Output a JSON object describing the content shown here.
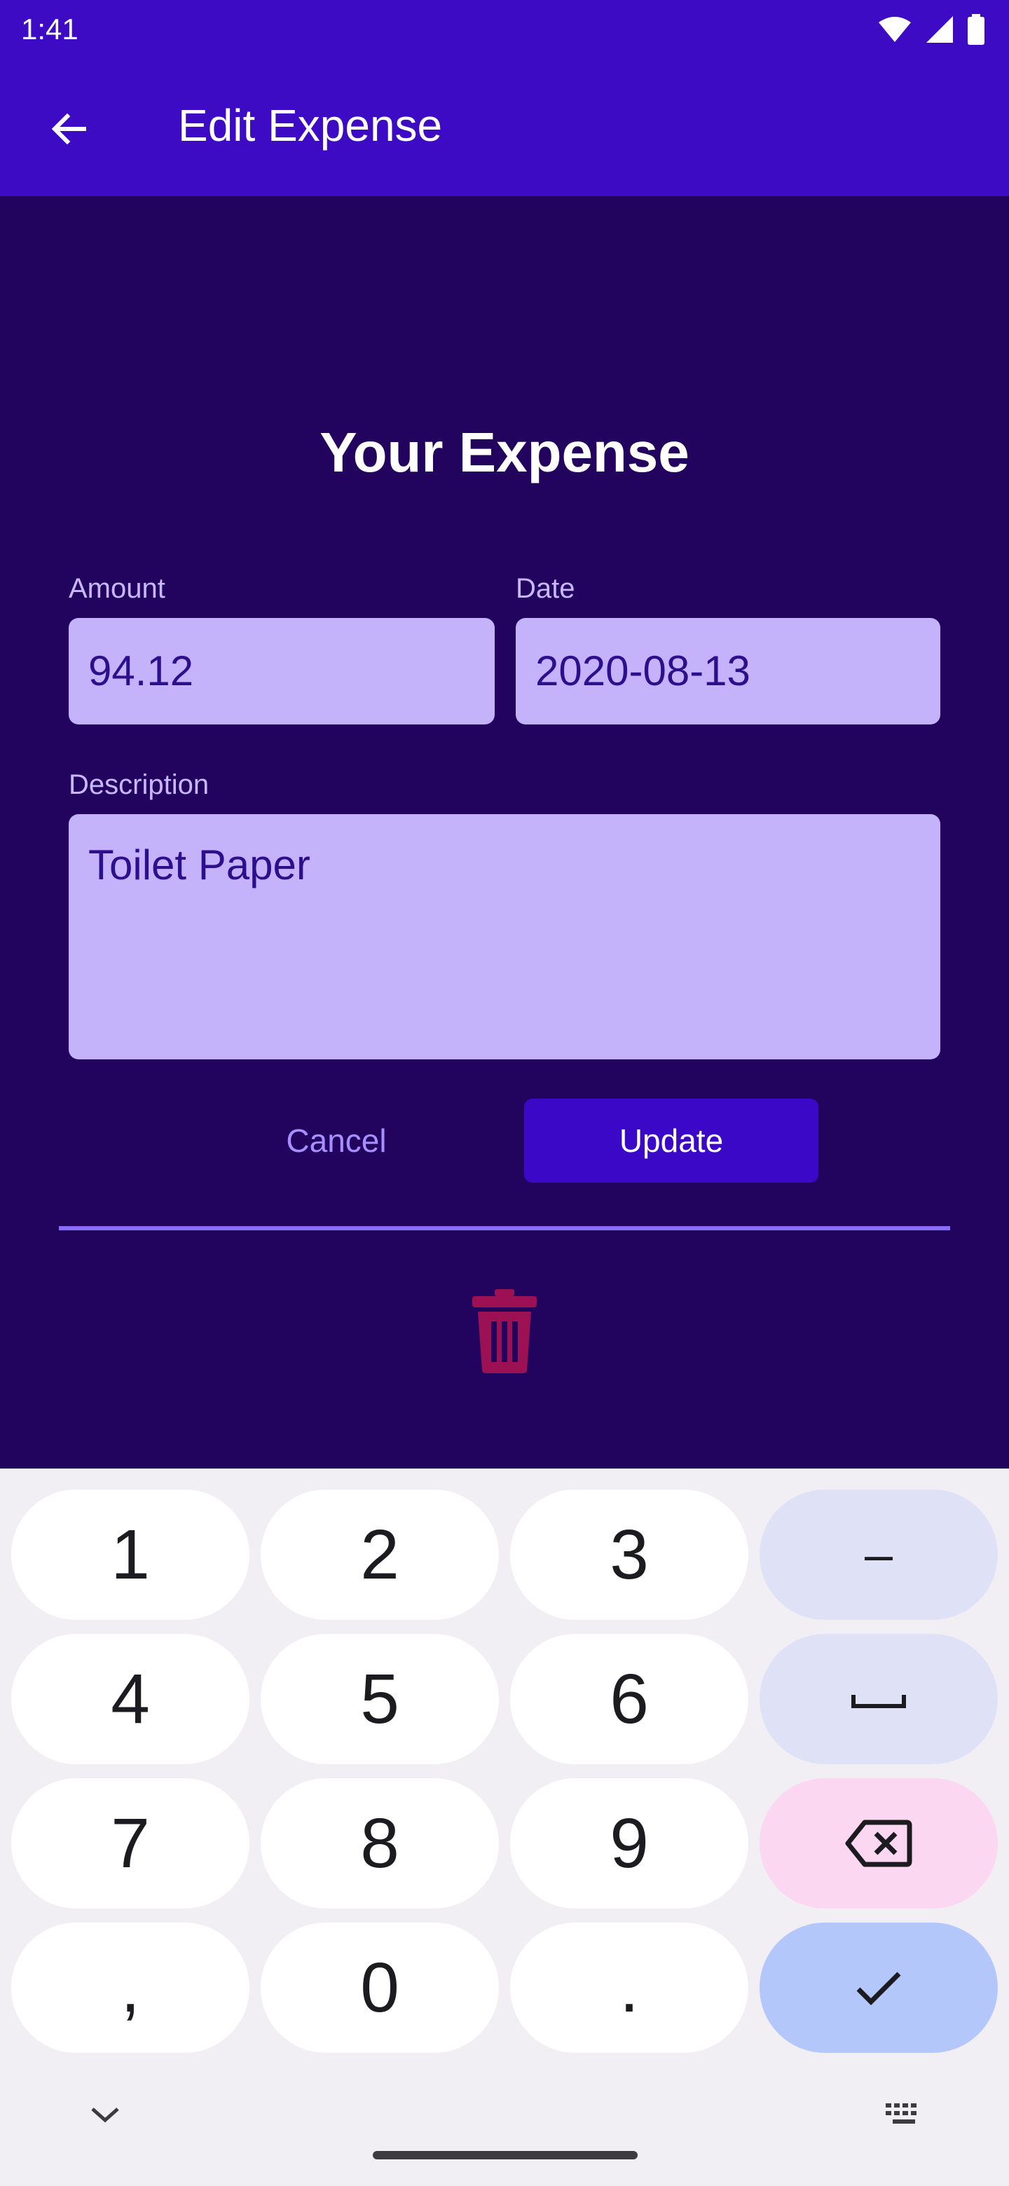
{
  "status": {
    "time": "1:41"
  },
  "appbar": {
    "title": "Edit Expense"
  },
  "form": {
    "heading": "Your Expense",
    "amount_label": "Amount",
    "amount_value": "94.12",
    "date_label": "Date",
    "date_value": "2020-08-13",
    "description_label": "Description",
    "description_value": "Toilet Paper",
    "cancel_label": "Cancel",
    "update_label": "Update"
  },
  "keyboard": {
    "keys": [
      "1",
      "2",
      "3",
      "–",
      "4",
      "5",
      "6",
      "␣",
      "7",
      "8",
      "9",
      "⌫",
      ",",
      "0",
      ".",
      "✓"
    ]
  },
  "colors": {
    "primary": "#3d0bc4",
    "background": "#22045f",
    "field": "#c4b3fb",
    "trash": "#9c1153"
  }
}
